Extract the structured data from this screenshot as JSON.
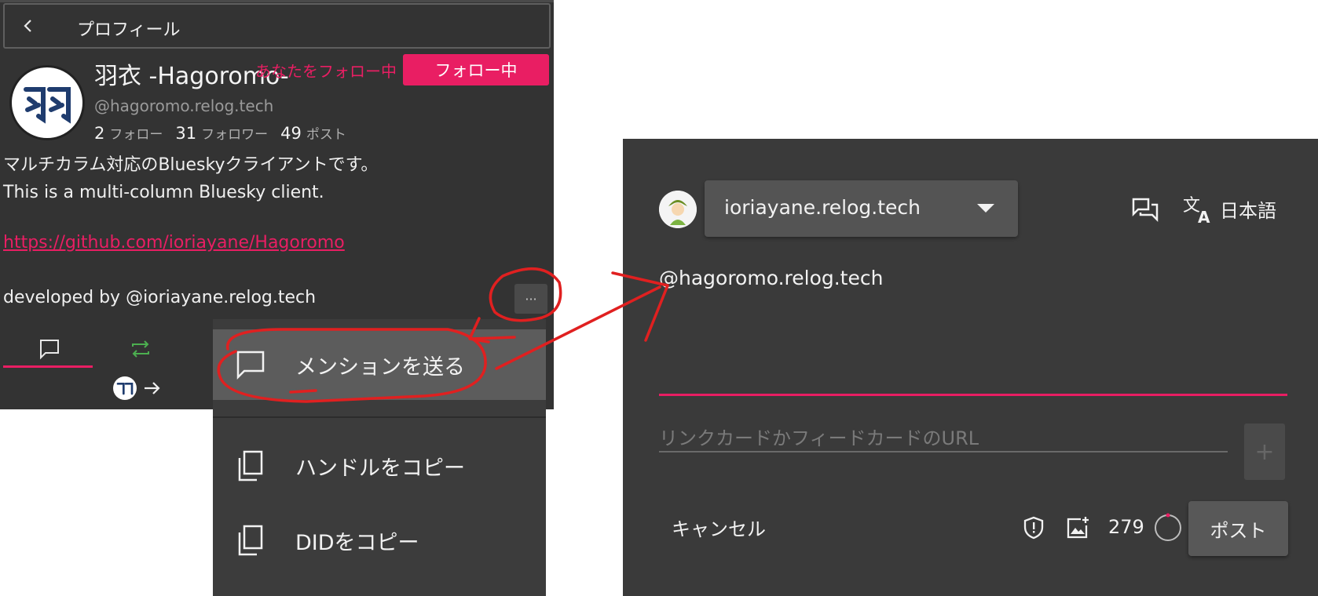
{
  "profile": {
    "header_title": "プロフィール",
    "display_name": "羽衣 -Hagoromo-",
    "follows_you": "あなたをフォロー中",
    "follow_button": "フォロー中",
    "handle": "@hagoromo.relog.tech",
    "stats": {
      "following_count": "2",
      "following_label": "フォロー",
      "followers_count": "31",
      "followers_label": "フォロワー",
      "posts_count": "49",
      "posts_label": "ポスト"
    },
    "bio_line1": "マルチカラム対応のBlueskyクライアントです。",
    "bio_line2": "This is a multi-column Bluesky client.",
    "bio_link": "https://github.com/ioriayane/Hagoromo",
    "bio_dev": "developed by @ioriayane.relog.tech",
    "more_label": "···",
    "avatar_glyph": "羽"
  },
  "context_menu": {
    "items": [
      {
        "label": "メンションを送る",
        "icon": "chat-bubble-icon"
      },
      {
        "label": "ハンドルをコピー",
        "icon": "copy-icon"
      },
      {
        "label": "DIDをコピー",
        "icon": "copy-icon"
      }
    ]
  },
  "composer": {
    "account": "ioriayane.relog.tech",
    "language": "日本語",
    "text": "@hagoromo.relog.tech",
    "url_placeholder": "リンクカードかフィードカードのURL",
    "add_label": "+",
    "cancel": "キャンセル",
    "char_count": "279",
    "post": "ポスト"
  },
  "colors": {
    "accent": "#e91e63",
    "panel": "#333333",
    "composer_bg": "#3a3a3a",
    "annotation": "#e02020"
  }
}
